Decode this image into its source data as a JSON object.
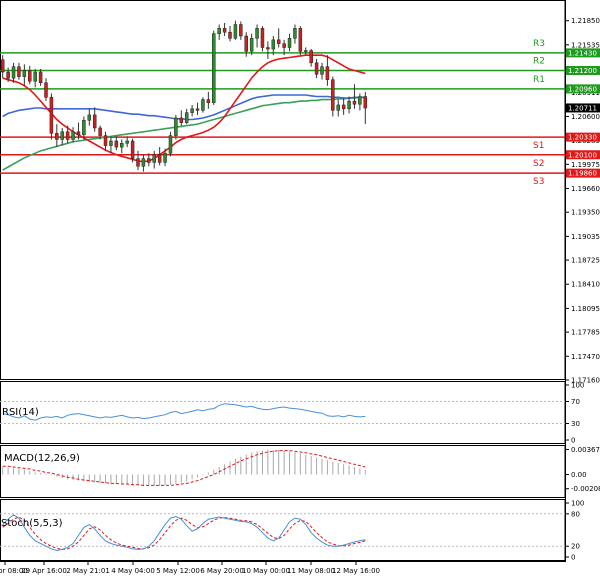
{
  "colors": {
    "up": "#2e8b2e",
    "down": "#d21e1e",
    "ma_fast": "#e01818",
    "ma_mid": "#3f67d6",
    "ma_slow": "#3aa05a",
    "resistance": "#1f9a1f",
    "support": "#e01818",
    "rsi": "#4a90d9",
    "macd_hist": "#a8a8a8",
    "macd_signal": "#e01818",
    "stoch_main": "#4a90d9",
    "stoch_signal": "#e01818"
  },
  "chart_data": [
    {
      "type": "candlestick",
      "ylim": [
        1.1716,
        1.2212
      ],
      "y_ticks": [
        "1.21850",
        "1.21535",
        "1.21215",
        "1.20911",
        "1.20600",
        "1.20285",
        "1.19975",
        "1.19660",
        "1.19350",
        "1.19035",
        "1.18725",
        "1.18410",
        "1.18095",
        "1.17785",
        "1.17470",
        "1.17160"
      ],
      "x_tick_labels": [
        "28 Apr 08:00",
        "29 Apr 16:00",
        "2 May 21:01",
        "4 May 04:00",
        "5 May 12:00",
        "6 May 20:00",
        "10 May 00:00",
        "11 May 08:00",
        "12 May 16:00"
      ],
      "last_price": "1.20711",
      "levels": [
        {
          "name": "R3",
          "value": 1.2143,
          "label": "1.21430",
          "kind": "resistance"
        },
        {
          "name": "R2",
          "value": 1.212,
          "label": "1.21200",
          "kind": "resistance"
        },
        {
          "name": "R1",
          "value": 1.2096,
          "label": "1.20960",
          "kind": "resistance"
        },
        {
          "name": "S1",
          "value": 1.2033,
          "label": "1.20330",
          "kind": "support"
        },
        {
          "name": "S2",
          "value": 1.201,
          "label": "1.20100",
          "kind": "support"
        },
        {
          "name": "S3",
          "value": 1.1986,
          "label": "1.19860",
          "kind": "support"
        }
      ],
      "candles": [
        {
          "o": 1.2134,
          "h": 1.214,
          "l": 1.211,
          "c": 1.2118
        },
        {
          "o": 1.2118,
          "h": 1.2124,
          "l": 1.2105,
          "c": 1.211
        },
        {
          "o": 1.211,
          "h": 1.213,
          "l": 1.2104,
          "c": 1.2125
        },
        {
          "o": 1.2125,
          "h": 1.213,
          "l": 1.2108,
          "c": 1.2112
        },
        {
          "o": 1.2112,
          "h": 1.2128,
          "l": 1.21,
          "c": 1.212
        },
        {
          "o": 1.212,
          "h": 1.2126,
          "l": 1.2102,
          "c": 1.2106
        },
        {
          "o": 1.2106,
          "h": 1.2122,
          "l": 1.2098,
          "c": 1.2118
        },
        {
          "o": 1.2118,
          "h": 1.2122,
          "l": 1.21,
          "c": 1.2104
        },
        {
          "o": 1.2104,
          "h": 1.211,
          "l": 1.208,
          "c": 1.2085
        },
        {
          "o": 1.2085,
          "h": 1.209,
          "l": 1.203,
          "c": 1.2038
        },
        {
          "o": 1.2038,
          "h": 1.205,
          "l": 1.202,
          "c": 1.203
        },
        {
          "o": 1.203,
          "h": 1.2045,
          "l": 1.2022,
          "c": 1.204
        },
        {
          "o": 1.204,
          "h": 1.2048,
          "l": 1.2025,
          "c": 1.203
        },
        {
          "o": 1.203,
          "h": 1.2046,
          "l": 1.2026,
          "c": 1.204
        },
        {
          "o": 1.204,
          "h": 1.2052,
          "l": 1.203,
          "c": 1.2036
        },
        {
          "o": 1.2036,
          "h": 1.206,
          "l": 1.203,
          "c": 1.2055
        },
        {
          "o": 1.2055,
          "h": 1.207,
          "l": 1.2048,
          "c": 1.2062
        },
        {
          "o": 1.2062,
          "h": 1.2072,
          "l": 1.204,
          "c": 1.2045
        },
        {
          "o": 1.2045,
          "h": 1.2048,
          "l": 1.203,
          "c": 1.2035
        },
        {
          "o": 1.2035,
          "h": 1.204,
          "l": 1.2015,
          "c": 1.2022
        },
        {
          "o": 1.2022,
          "h": 1.2034,
          "l": 1.2012,
          "c": 1.2028
        },
        {
          "o": 1.2028,
          "h": 1.2034,
          "l": 1.2016,
          "c": 1.202
        },
        {
          "o": 1.202,
          "h": 1.203,
          "l": 1.2012,
          "c": 1.2025
        },
        {
          "o": 1.2025,
          "h": 1.2034,
          "l": 1.202,
          "c": 1.2028
        },
        {
          "o": 1.2028,
          "h": 1.2031,
          "l": 1.2,
          "c": 1.2005
        },
        {
          "o": 1.2005,
          "h": 1.2015,
          "l": 1.199,
          "c": 1.1995
        },
        {
          "o": 1.1995,
          "h": 1.201,
          "l": 1.1988,
          "c": 1.2005
        },
        {
          "o": 1.2005,
          "h": 1.2012,
          "l": 1.1995,
          "c": 1.2
        },
        {
          "o": 1.2,
          "h": 1.2015,
          "l": 1.1992,
          "c": 1.201
        },
        {
          "o": 1.201,
          "h": 1.202,
          "l": 1.1996,
          "c": 1.2
        },
        {
          "o": 1.2,
          "h": 1.2018,
          "l": 1.1995,
          "c": 1.2012
        },
        {
          "o": 1.2012,
          "h": 1.204,
          "l": 1.2008,
          "c": 1.2035
        },
        {
          "o": 1.2035,
          "h": 1.2062,
          "l": 1.203,
          "c": 1.2058
        },
        {
          "o": 1.2058,
          "h": 1.2068,
          "l": 1.2048,
          "c": 1.2052
        },
        {
          "o": 1.2052,
          "h": 1.207,
          "l": 1.205,
          "c": 1.2065
        },
        {
          "o": 1.2065,
          "h": 1.2075,
          "l": 1.206,
          "c": 1.207
        },
        {
          "o": 1.207,
          "h": 1.2078,
          "l": 1.2062,
          "c": 1.2068
        },
        {
          "o": 1.2068,
          "h": 1.2085,
          "l": 1.2065,
          "c": 1.2082
        },
        {
          "o": 1.2082,
          "h": 1.2092,
          "l": 1.207,
          "c": 1.2078
        },
        {
          "o": 1.2078,
          "h": 1.2172,
          "l": 1.2075,
          "c": 1.2168
        },
        {
          "o": 1.2168,
          "h": 1.218,
          "l": 1.216,
          "c": 1.2175
        },
        {
          "o": 1.2175,
          "h": 1.2182,
          "l": 1.2165,
          "c": 1.217
        },
        {
          "o": 1.217,
          "h": 1.2178,
          "l": 1.2158,
          "c": 1.2162
        },
        {
          "o": 1.2162,
          "h": 1.2185,
          "l": 1.216,
          "c": 1.218
        },
        {
          "o": 1.218,
          "h": 1.2184,
          "l": 1.216,
          "c": 1.2165
        },
        {
          "o": 1.2165,
          "h": 1.217,
          "l": 1.2138,
          "c": 1.2145
        },
        {
          "o": 1.2145,
          "h": 1.2168,
          "l": 1.214,
          "c": 1.2162
        },
        {
          "o": 1.2162,
          "h": 1.218,
          "l": 1.215,
          "c": 1.2175
        },
        {
          "o": 1.2175,
          "h": 1.2178,
          "l": 1.2145,
          "c": 1.215
        },
        {
          "o": 1.215,
          "h": 1.2158,
          "l": 1.2135,
          "c": 1.2148
        },
        {
          "o": 1.2148,
          "h": 1.2165,
          "l": 1.214,
          "c": 1.216
        },
        {
          "o": 1.216,
          "h": 1.2175,
          "l": 1.215,
          "c": 1.2155
        },
        {
          "o": 1.2155,
          "h": 1.216,
          "l": 1.214,
          "c": 1.215
        },
        {
          "o": 1.215,
          "h": 1.2168,
          "l": 1.2145,
          "c": 1.2162
        },
        {
          "o": 1.2162,
          "h": 1.218,
          "l": 1.2155,
          "c": 1.2175
        },
        {
          "o": 1.2175,
          "h": 1.2178,
          "l": 1.214,
          "c": 1.2145
        },
        {
          "o": 1.2145,
          "h": 1.215,
          "l": 1.214,
          "c": 1.2146
        },
        {
          "o": 1.2146,
          "h": 1.2148,
          "l": 1.2125,
          "c": 1.213
        },
        {
          "o": 1.213,
          "h": 1.2135,
          "l": 1.211,
          "c": 1.2115
        },
        {
          "o": 1.2115,
          "h": 1.213,
          "l": 1.2108,
          "c": 1.2125
        },
        {
          "o": 1.2125,
          "h": 1.214,
          "l": 1.21,
          "c": 1.2108
        },
        {
          "o": 1.2108,
          "h": 1.2112,
          "l": 1.206,
          "c": 1.2068
        },
        {
          "o": 1.2068,
          "h": 1.2082,
          "l": 1.206,
          "c": 1.2075
        },
        {
          "o": 1.2075,
          "h": 1.2084,
          "l": 1.2062,
          "c": 1.207
        },
        {
          "o": 1.207,
          "h": 1.2086,
          "l": 1.2064,
          "c": 1.208
        },
        {
          "o": 1.208,
          "h": 1.2102,
          "l": 1.207,
          "c": 1.2076
        },
        {
          "o": 1.2076,
          "h": 1.209,
          "l": 1.2068,
          "c": 1.2086
        },
        {
          "o": 1.2086,
          "h": 1.2092,
          "l": 1.205,
          "c": 1.2071
        }
      ],
      "ma_fast": [
        1.211,
        1.2108,
        1.2106,
        1.2104,
        1.21,
        1.2095,
        1.2088,
        1.208,
        1.2072,
        1.2064,
        1.2056,
        1.205,
        1.2045,
        1.204,
        1.2036,
        1.2032,
        1.2028,
        1.2024,
        1.202,
        1.2016,
        1.2013,
        1.201,
        1.2008,
        1.2006,
        1.2004,
        1.2002,
        1.2001,
        1.2002,
        1.2005,
        1.201,
        1.2015,
        1.202,
        1.2026,
        1.203,
        1.2033,
        1.2035,
        1.2037,
        1.2039,
        1.2042,
        1.2046,
        1.2052,
        1.206,
        1.207,
        1.208,
        1.209,
        1.21,
        1.211,
        1.2118,
        1.2125,
        1.213,
        1.2133,
        1.2135,
        1.2136,
        1.2137,
        1.2138,
        1.2139,
        1.214,
        1.214,
        1.214,
        1.214,
        1.2138,
        1.2134,
        1.213,
        1.2126,
        1.2122,
        1.212,
        1.2118,
        1.2116
      ],
      "ma_mid": [
        1.206,
        1.2064,
        1.2066,
        1.2068,
        1.2069,
        1.207,
        1.2071,
        1.2071,
        1.207,
        1.207,
        1.207,
        1.207,
        1.207,
        1.207,
        1.207,
        1.207,
        1.207,
        1.207,
        1.2069,
        1.2068,
        1.2067,
        1.2066,
        1.2065,
        1.2064,
        1.2063,
        1.2063,
        1.2062,
        1.2061,
        1.2061,
        1.206,
        1.2059,
        1.2058,
        1.2057,
        1.2057,
        1.2056,
        1.2056,
        1.2057,
        1.2058,
        1.206,
        1.2062,
        1.2065,
        1.2068,
        1.2071,
        1.2074,
        1.2077,
        1.208,
        1.2083,
        1.2085,
        1.2086,
        1.2087,
        1.2088,
        1.2088,
        1.2088,
        1.2088,
        1.2088,
        1.2088,
        1.2088,
        1.2087,
        1.2086,
        1.2086,
        1.2086,
        1.2085,
        1.2085,
        1.2084,
        1.2084,
        1.2085,
        1.2085,
        1.2085
      ],
      "ma_slow": [
        1.199,
        1.1994,
        1.1998,
        1.2002,
        1.2006,
        1.2009,
        1.2012,
        1.2015,
        1.2017,
        1.2019,
        1.2021,
        1.2023,
        1.2025,
        1.2027,
        1.2028,
        1.2029,
        1.203,
        1.2031,
        1.2032,
        1.2033,
        1.2034,
        1.2035,
        1.2036,
        1.2037,
        1.2038,
        1.2039,
        1.204,
        1.2041,
        1.2042,
        1.2043,
        1.2044,
        1.2045,
        1.2046,
        1.2047,
        1.2048,
        1.2049,
        1.205,
        1.2052,
        1.2054,
        1.2056,
        1.2058,
        1.206,
        1.2062,
        1.2064,
        1.2066,
        1.2068,
        1.207,
        1.2072,
        1.2074,
        1.2075,
        1.2076,
        1.2077,
        1.2078,
        1.2078,
        1.2079,
        1.208,
        1.208,
        1.2081,
        1.2081,
        1.2082,
        1.2082,
        1.2082,
        1.2083,
        1.2083,
        1.2084,
        1.2084,
        1.2085,
        1.2085
      ]
    },
    {
      "type": "line",
      "title": "RSI(14)",
      "ylim": [
        0,
        100
      ],
      "y_ticks": [
        "100",
        "70",
        "30",
        "0"
      ],
      "series": [
        {
          "name": "RSI(14)",
          "values": [
            48,
            46,
            42,
            40,
            44,
            38,
            36,
            40,
            42,
            41,
            43,
            40,
            45,
            47,
            48,
            46,
            44,
            42,
            40,
            42,
            41,
            43,
            45,
            42,
            40,
            41,
            39,
            40,
            42,
            44,
            46,
            50,
            52,
            48,
            50,
            52,
            55,
            53,
            56,
            57,
            63,
            66,
            65,
            64,
            62,
            60,
            61,
            58,
            56,
            55,
            57,
            59,
            60,
            58,
            57,
            56,
            54,
            52,
            50,
            49,
            44,
            43,
            44,
            42,
            45,
            43,
            42,
            43
          ]
        }
      ]
    },
    {
      "type": "bar",
      "title": "MACD(12,26,9)",
      "ylim": [
        -0.00286,
        0.00374
      ],
      "y_ticks": [
        "0.003674",
        "0.00",
        "-0.002086"
      ],
      "series": [
        {
          "name": "histogram",
          "values": [
            0.0011,
            0.001,
            0.0009,
            0.0008,
            0.0007,
            0.0005,
            0.0003,
            0.0002,
            0.0001,
            -0.0001,
            -0.0003,
            -0.0005,
            -0.0007,
            -0.0008,
            -0.0009,
            -0.001,
            -0.0011,
            -0.0012,
            -0.0013,
            -0.0013,
            -0.0014,
            -0.0014,
            -0.0015,
            -0.0015,
            -0.0016,
            -0.0016,
            -0.0017,
            -0.0017,
            -0.0017,
            -0.0017,
            -0.0016,
            -0.0015,
            -0.0014,
            -0.0012,
            -0.001,
            -0.0007,
            -0.0004,
            -0.0001,
            0.0003,
            0.0007,
            0.0011,
            0.0015,
            0.0019,
            0.0023,
            0.0026,
            0.0029,
            0.0032,
            0.0034,
            0.0035,
            0.0036,
            0.0036,
            0.0036,
            0.0035,
            0.0034,
            0.0033,
            0.0031,
            0.0029,
            0.0027,
            0.0025,
            0.0023,
            0.0021,
            0.0019,
            0.0017,
            0.0015,
            0.0013,
            0.0011,
            0.0009,
            0.0007
          ]
        },
        {
          "name": "signal",
          "values": [
            0.0012,
            0.0012,
            0.0011,
            0.001,
            0.0009,
            0.0008,
            0.0006,
            0.0005,
            0.0003,
            0.0002,
            0.0,
            -0.0002,
            -0.0004,
            -0.0005,
            -0.0007,
            -0.0008,
            -0.0009,
            -0.001,
            -0.0011,
            -0.0012,
            -0.0013,
            -0.0013,
            -0.0014,
            -0.0014,
            -0.0015,
            -0.0015,
            -0.0016,
            -0.0016,
            -0.0016,
            -0.0016,
            -0.0016,
            -0.0016,
            -0.0015,
            -0.0014,
            -0.0013,
            -0.0011,
            -0.0009,
            -0.0006,
            -0.0003,
            0.0,
            0.0004,
            0.0008,
            0.0012,
            0.0016,
            0.002,
            0.0023,
            0.0026,
            0.0029,
            0.0031,
            0.0033,
            0.0034,
            0.0035,
            0.0035,
            0.0035,
            0.0034,
            0.0033,
            0.0032,
            0.003,
            0.0029,
            0.0027,
            0.0025,
            0.0023,
            0.0021,
            0.0019,
            0.0017,
            0.0015,
            0.0013,
            0.0011
          ]
        }
      ]
    },
    {
      "type": "line",
      "title": "Stoch(5,5,3)",
      "ylim": [
        0,
        100
      ],
      "y_ticks": [
        "100",
        "80",
        "20",
        "0"
      ],
      "series": [
        {
          "name": "main",
          "values": [
            60,
            70,
            78,
            72,
            55,
            40,
            30,
            25,
            20,
            15,
            12,
            14,
            18,
            25,
            40,
            55,
            60,
            52,
            40,
            30,
            25,
            22,
            20,
            18,
            15,
            14,
            15,
            20,
            30,
            45,
            60,
            72,
            75,
            70,
            58,
            48,
            52,
            62,
            70,
            72,
            74,
            72,
            70,
            68,
            66,
            65,
            62,
            55,
            45,
            35,
            30,
            35,
            50,
            65,
            72,
            70,
            60,
            45,
            35,
            28,
            22,
            20,
            20,
            22,
            25,
            28,
            30,
            32
          ]
        },
        {
          "name": "signal",
          "values": [
            55,
            62,
            70,
            74,
            68,
            55,
            42,
            32,
            25,
            20,
            16,
            14,
            15,
            20,
            28,
            40,
            52,
            56,
            50,
            40,
            32,
            26,
            22,
            20,
            18,
            16,
            15,
            17,
            22,
            32,
            45,
            58,
            68,
            72,
            68,
            60,
            54,
            56,
            62,
            68,
            72,
            73,
            72,
            70,
            68,
            67,
            65,
            60,
            52,
            44,
            36,
            34,
            40,
            52,
            62,
            68,
            66,
            56,
            45,
            36,
            28,
            24,
            21,
            21,
            22,
            25,
            27,
            30
          ]
        }
      ]
    }
  ]
}
